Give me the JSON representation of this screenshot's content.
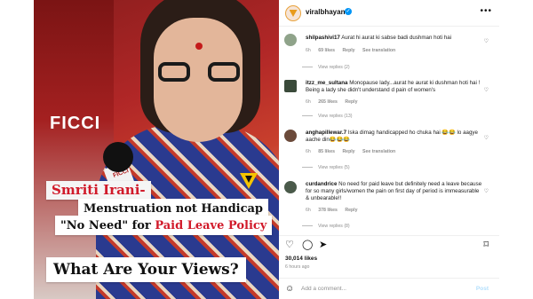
{
  "post_image": {
    "bg_text": "FICCI",
    "mic_label": "FICCI",
    "caption_name": "Smriti Irani-",
    "caption_line2": "Menstruation not Handicap",
    "caption_line3_a": "\"No Need\" for ",
    "caption_line3_b": "Paid Leave Policy",
    "caption_views": "What Are Your Views?"
  },
  "header": {
    "username": "viralbhayani",
    "verified_icon": "✓",
    "more_icon": "•••"
  },
  "comments": [
    {
      "username": "shilpashivi17",
      "text": " Aurat hi aurat ki sabse badi dushman hoti hai",
      "time": "6h",
      "likes": "69 likes",
      "reply": "Reply",
      "translate": "See translation",
      "view_replies": "View replies (2)",
      "avatar_color": "#8fa38a"
    },
    {
      "username": "itzz_me_sultana",
      "text": " Monopause lady...aurat he aurat ki dushman hoti hai ! Being a lady she didn't understand d pain of women's",
      "time": "6h",
      "likes": "265 likes",
      "reply": "Reply",
      "translate": "",
      "view_replies": "View replies (13)",
      "avatar_color": "#3a4a3a"
    },
    {
      "username": "anghapillewar.7",
      "text": " Iska dimag handicapped ho chuka hai 😂😂 lo aagye aache din😂😂😂",
      "time": "6h",
      "likes": "85 likes",
      "reply": "Reply",
      "translate": "See translation",
      "view_replies": "View replies (5)",
      "avatar_color": "#6b4a3a"
    },
    {
      "username": "curdandrice",
      "text": " No need for paid leave but definitely need a leave because for so many girls/women the pain on first day of period is immeasurable & unbearable!!",
      "time": "6h",
      "likes": "378 likes",
      "reply": "Reply",
      "translate": "",
      "view_replies": "View replies (8)",
      "avatar_color": "#4a5a4a"
    }
  ],
  "actions": {
    "heart_icon": "♡",
    "comment_icon": "◯",
    "share_icon": "➤",
    "bookmark_icon": "⌑"
  },
  "likes_count": "30,014 likes",
  "posted_time": "6 hours ago",
  "add_comment": {
    "emoji_icon": "☺",
    "placeholder": "Add a comment...",
    "post_label": "Post"
  }
}
